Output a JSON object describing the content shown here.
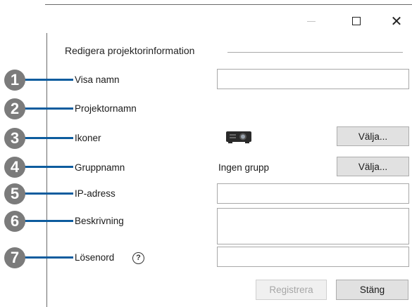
{
  "window": {
    "minimize_icon": "minimize-icon",
    "maximize_icon": "maximize-icon",
    "close_glyph": "✕"
  },
  "section": {
    "title": "Redigera projektorinformation"
  },
  "callouts": [
    "1",
    "2",
    "3",
    "4",
    "5",
    "6",
    "7"
  ],
  "fields": {
    "display_name": {
      "label": "Visa namn",
      "value": ""
    },
    "projector_name": {
      "label": "Projektornamn",
      "value": ""
    },
    "icons": {
      "label": "Ikoner",
      "button": "Välja...",
      "icon": "projector-icon"
    },
    "group_name": {
      "label": "Gruppnamn",
      "value": "Ingen grupp",
      "button": "Välja..."
    },
    "ip_address": {
      "label": "IP-adress",
      "value": ""
    },
    "description": {
      "label": "Beskrivning",
      "value": ""
    },
    "password": {
      "label": "Lösenord",
      "value": "",
      "help": "?"
    }
  },
  "buttons": {
    "register": "Registrera",
    "close": "Stäng"
  },
  "colors": {
    "callout_bg": "#7b7b7b",
    "callout_line": "#0d5c9e",
    "button_bg": "#e1e1e1",
    "disabled_text": "#a6a6a6"
  }
}
